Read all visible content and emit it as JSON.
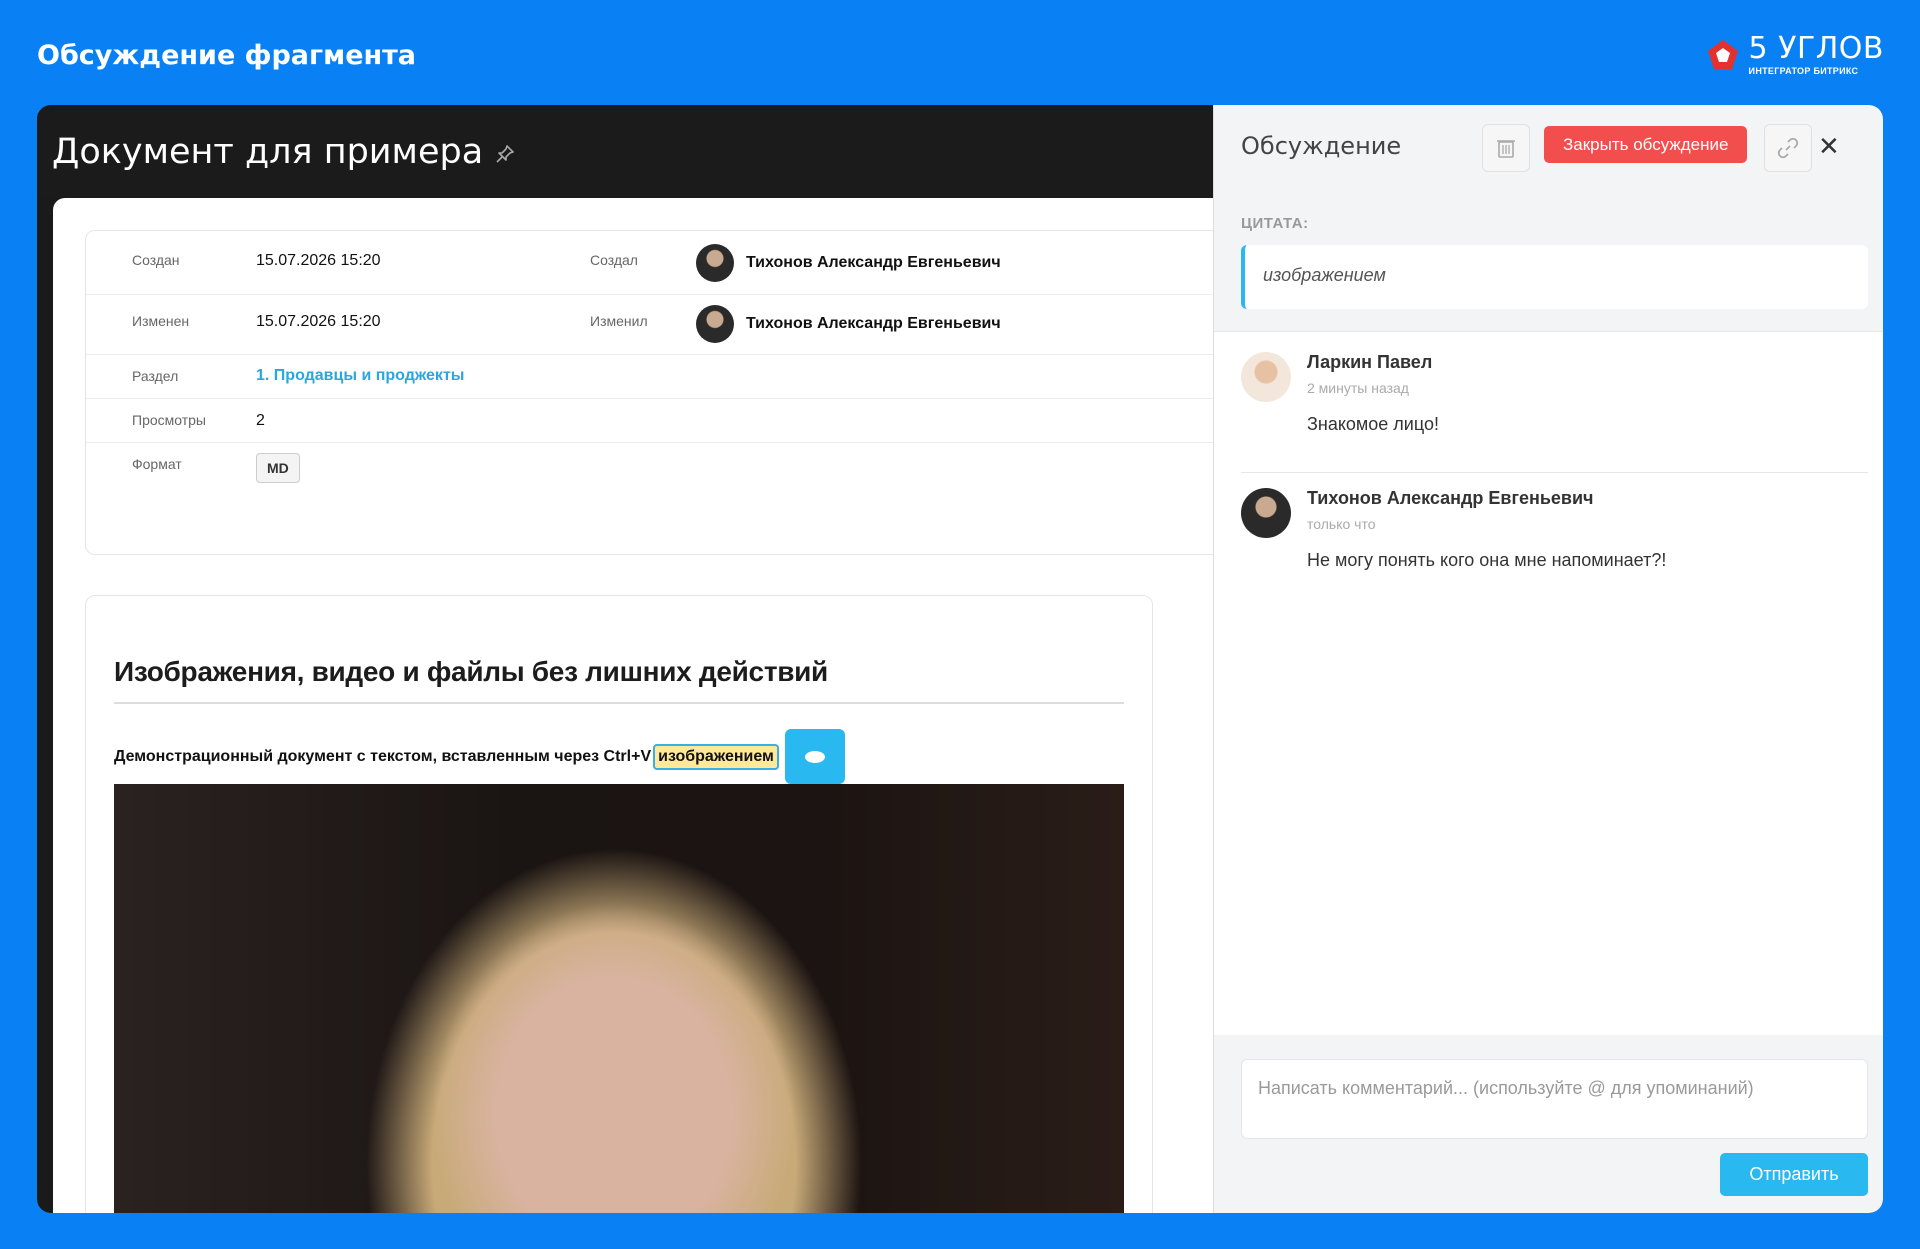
{
  "banner": {
    "title": "Обсуждение фрагмента"
  },
  "brand": {
    "name": "5 УГЛОВ",
    "subtitle": "ИНТЕГРАТОР БИТРИКС",
    "accent": "#e2312f"
  },
  "document": {
    "title": "Документ для примера",
    "meta": {
      "created_label": "Создан",
      "created_value": "15.07.2026 15:20",
      "created_by_label": "Создал",
      "created_by": "Тихонов Александр Евгеньевич",
      "modified_label": "Изменен",
      "modified_value": "15.07.2026 15:20",
      "modified_by_label": "Изменил",
      "modified_by": "Тихонов Александр Евгеньевич",
      "section_label": "Раздел",
      "section_value": "1. Продавцы и проджекты",
      "views_label": "Просмотры",
      "views_value": "2",
      "format_label": "Формат",
      "format_value": "MD"
    },
    "content": {
      "heading": "Изображения, видео и файлы без лишних действий",
      "text_before": "Демонстрационный документ с текстом, вставленным через Ctrl+V",
      "highlight": "изображением"
    }
  },
  "panel": {
    "title": "Обсуждение",
    "close_discussion_label": "Закрыть обсуждение",
    "close_symbol": "✕",
    "quote_label": "ЦИТАТА:",
    "quote_text": "изображением",
    "comments": [
      {
        "author": "Ларкин Павел",
        "time": "2 минуты назад",
        "text": "Знакомое лицо!"
      },
      {
        "author": "Тихонов Александр Евгеньевич",
        "time": "только что",
        "text": "Не могу понять кого она мне напоминает?!"
      }
    ],
    "composer_placeholder": "Написать комментарий... (используйте @ для упоминаний)",
    "send_label": "Отправить"
  },
  "colors": {
    "background": "#0a80f5",
    "accent_blue": "#2ab8f0",
    "danger": "#f24e4e",
    "highlight": "#ffe89a"
  }
}
